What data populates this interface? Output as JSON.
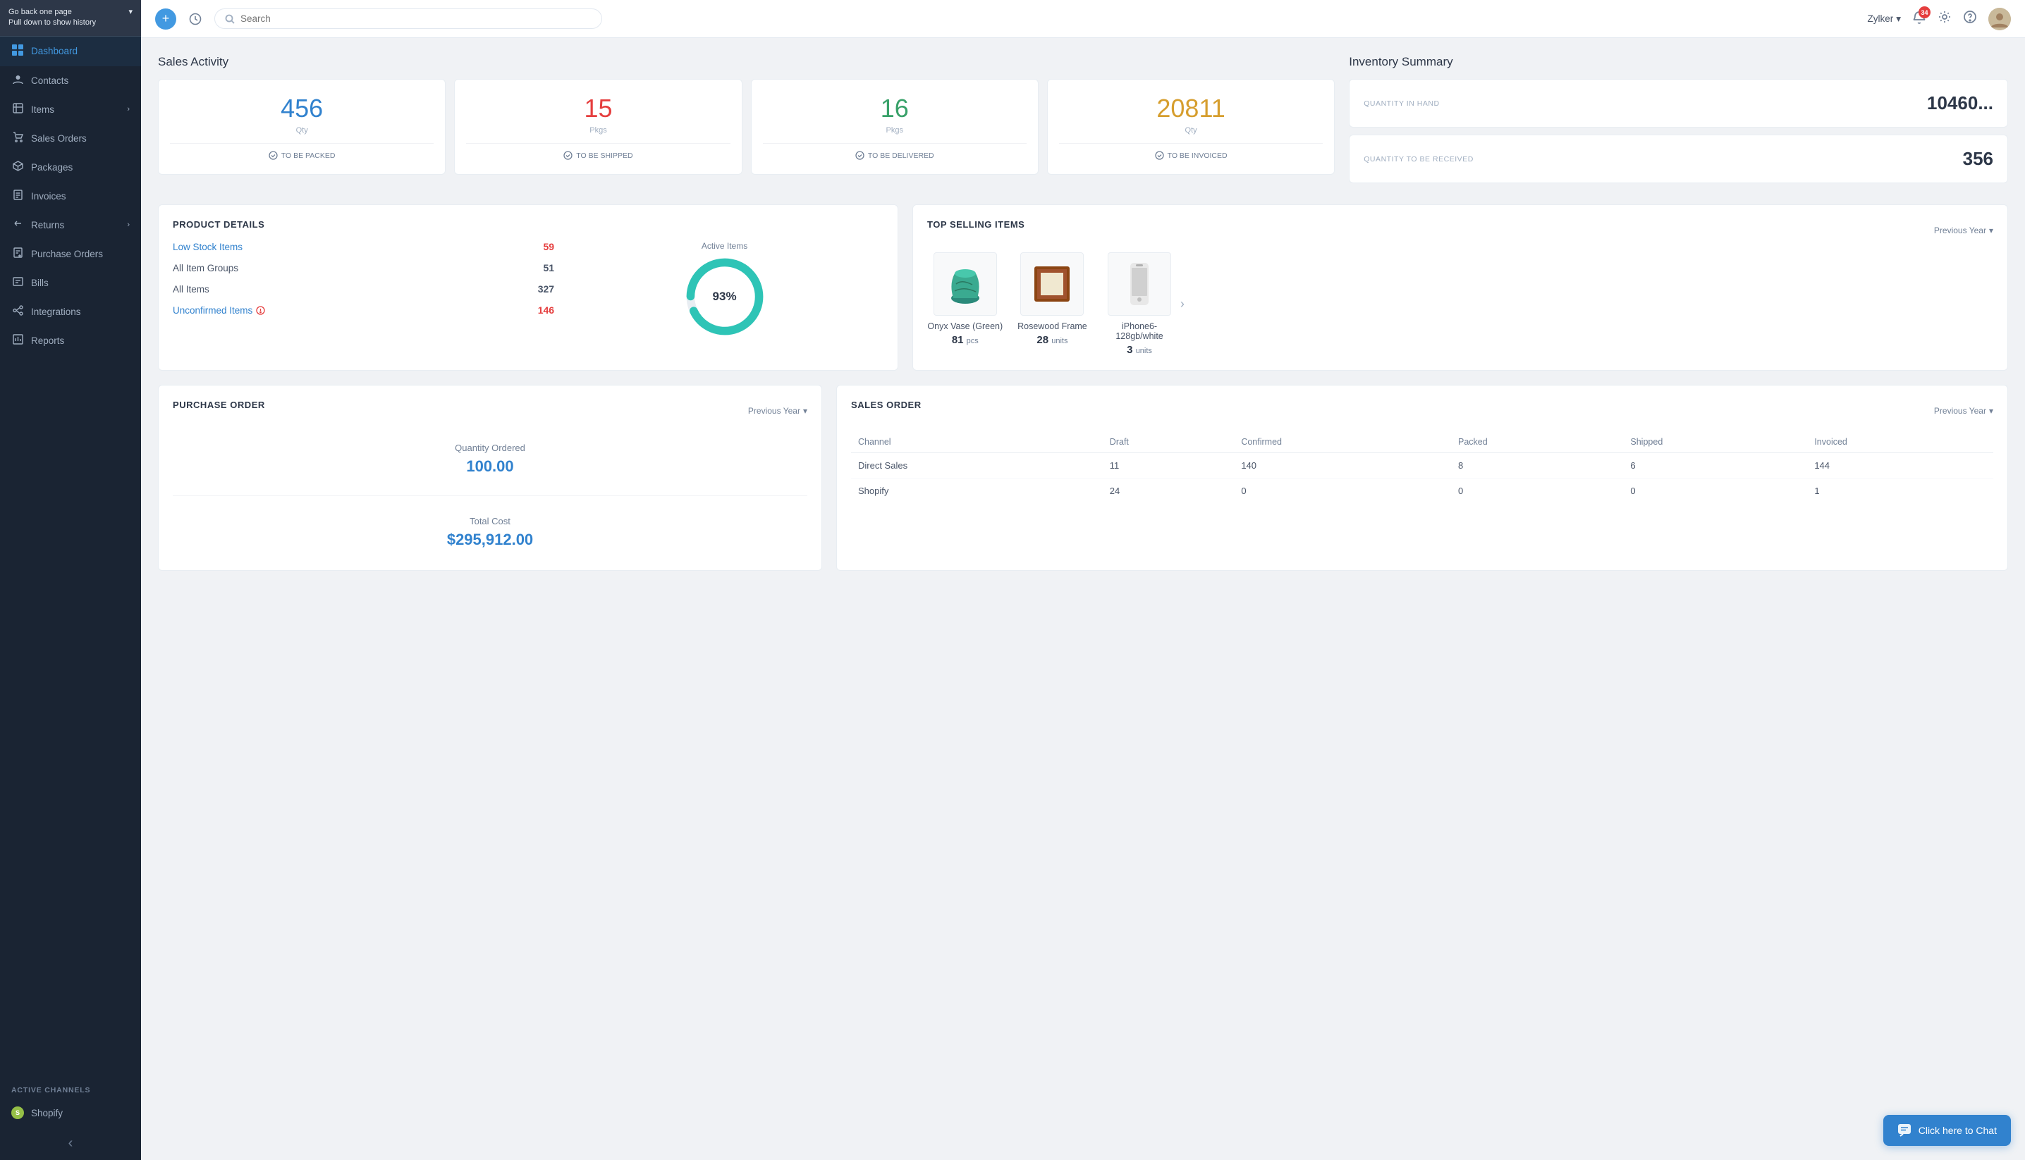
{
  "sidebar": {
    "back_text": "Go back one page\nPull down to show history",
    "items": [
      {
        "id": "dashboard",
        "label": "Dashboard",
        "icon": "⊞",
        "active": true
      },
      {
        "id": "contacts",
        "label": "Contacts",
        "icon": "👤"
      },
      {
        "id": "items",
        "label": "Items",
        "icon": "📦",
        "has_chevron": true
      },
      {
        "id": "sales-orders",
        "label": "Sales Orders",
        "icon": "🛒"
      },
      {
        "id": "packages",
        "label": "Packages",
        "icon": "📦"
      },
      {
        "id": "invoices",
        "label": "Invoices",
        "icon": "📄"
      },
      {
        "id": "returns",
        "label": "Returns",
        "icon": "↩",
        "has_chevron": true
      },
      {
        "id": "purchase-orders",
        "label": "Purchase Orders",
        "icon": "📋"
      },
      {
        "id": "bills",
        "label": "Bills",
        "icon": "🧾"
      },
      {
        "id": "integrations",
        "label": "Integrations",
        "icon": "🔗"
      },
      {
        "id": "reports",
        "label": "Reports",
        "icon": "📊"
      }
    ],
    "active_channels_label": "ACTIVE CHANNELS",
    "shopify_label": "Shopify"
  },
  "topbar": {
    "search_placeholder": "Search",
    "user_name": "Zylker",
    "notification_count": "34"
  },
  "sales_activity": {
    "title": "Sales Activity",
    "cards": [
      {
        "value": "456",
        "unit": "Qty",
        "status": "TO BE PACKED",
        "color": "blue"
      },
      {
        "value": "15",
        "unit": "Pkgs",
        "status": "TO BE SHIPPED",
        "color": "red"
      },
      {
        "value": "16",
        "unit": "Pkgs",
        "status": "TO BE DELIVERED",
        "color": "green"
      },
      {
        "value": "20811",
        "unit": "Qty",
        "status": "TO BE INVOICED",
        "color": "orange"
      }
    ]
  },
  "inventory_summary": {
    "title": "Inventory Summary",
    "quantity_in_hand_label": "QUANTITY IN HAND",
    "quantity_in_hand_value": "10460...",
    "quantity_to_receive_label": "QUANTITY TO BE RECEIVED",
    "quantity_to_receive_value": "356"
  },
  "product_details": {
    "title": "PRODUCT DETAILS",
    "rows": [
      {
        "label": "Low Stock Items",
        "value": "59",
        "highlight": true,
        "value_color": "red"
      },
      {
        "label": "All Item Groups",
        "value": "51",
        "highlight": false,
        "value_color": "normal"
      },
      {
        "label": "All Items",
        "value": "327",
        "highlight": false,
        "value_color": "normal"
      },
      {
        "label": "Unconfirmed Items",
        "value": "146",
        "highlight": true,
        "value_color": "red"
      }
    ],
    "donut": {
      "label": "Active Items",
      "percentage": "93%",
      "value": 93,
      "color_filled": "#2ec4b6",
      "color_empty": "#e8edf2"
    }
  },
  "top_selling": {
    "title": "TOP SELLING ITEMS",
    "period": "Previous Year",
    "items": [
      {
        "name": "Onyx Vase (Green)",
        "qty": "81",
        "unit": "pcs"
      },
      {
        "name": "Rosewood Frame",
        "qty": "28",
        "unit": "units"
      },
      {
        "name": "iPhone6-128gb/white",
        "qty": "3",
        "unit": "units"
      }
    ]
  },
  "purchase_order": {
    "title": "PURCHASE ORDER",
    "period": "Previous Year",
    "qty_ordered_label": "Quantity Ordered",
    "qty_ordered_value": "100.00",
    "total_cost_label": "Total Cost",
    "total_cost_value": "$295,912.00"
  },
  "sales_order": {
    "title": "SALES ORDER",
    "period": "Previous Year",
    "columns": [
      "Channel",
      "Draft",
      "Confirmed",
      "Packed",
      "Shipped",
      "Invoiced"
    ],
    "rows": [
      {
        "channel": "Direct Sales",
        "draft": "11",
        "confirmed": "140",
        "packed": "8",
        "shipped": "6",
        "invoiced": "144"
      },
      {
        "channel": "Shopify",
        "draft": "24",
        "confirmed": "0",
        "packed": "0",
        "shipped": "0",
        "invoiced": "1"
      }
    ]
  },
  "chat": {
    "label": "Click here to Chat"
  }
}
